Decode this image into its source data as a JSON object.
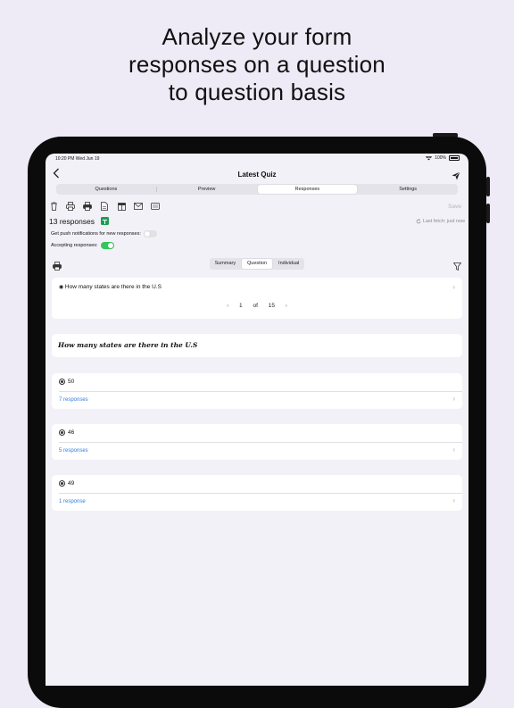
{
  "headline": [
    "Analyze your form",
    "responses on a question",
    "to question basis"
  ],
  "status": {
    "time": "10:20 PM  Wed Jun 19",
    "battery": "100%"
  },
  "nav": {
    "title": "Latest Quiz",
    "back_icon": "chevron-left-icon",
    "send_icon": "paper-plane-icon"
  },
  "tabs": [
    {
      "label": "Questions",
      "active": false
    },
    {
      "label": "Preview",
      "active": false
    },
    {
      "label": "Responses",
      "active": true
    },
    {
      "label": "Settings",
      "active": false
    }
  ],
  "toolbar": {
    "icons": [
      "trash-icon",
      "print-icon",
      "print-all-icon",
      "document-icon",
      "table-icon",
      "mail-icon",
      "card-icon"
    ],
    "save_label": "Save"
  },
  "responses": {
    "count_label": "13 responses",
    "last_fetch": "Last fetch: just now",
    "push_label": "Get push notifications for new responses:",
    "push_on": false,
    "accepting_label": "Accepting responses:",
    "accepting_on": true
  },
  "view_modes": [
    {
      "label": "Summary",
      "active": false
    },
    {
      "label": "Question",
      "active": true
    },
    {
      "label": "Individual",
      "active": false
    }
  ],
  "question_selector": {
    "label": "How many states are there in the U.S",
    "page": "1",
    "of": "of",
    "total": "15"
  },
  "question_title": "How many states are there in the U.S",
  "options": [
    {
      "value": "50",
      "responses": "7 responses"
    },
    {
      "value": "46",
      "responses": "5 responses"
    },
    {
      "value": "49",
      "responses": "1 response"
    }
  ],
  "colors": {
    "background": "#eeeaf6",
    "accent": "#2f7de1",
    "toggle_on": "#34c759",
    "sheets": "#1f9d55"
  }
}
